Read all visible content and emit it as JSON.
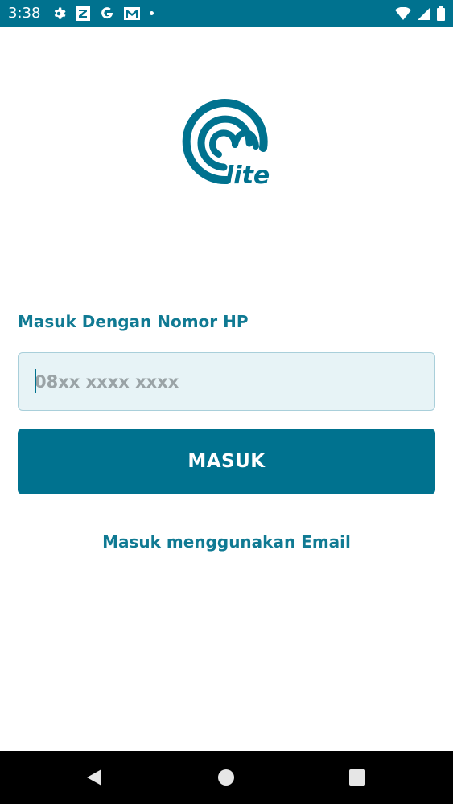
{
  "status_bar": {
    "time": "3:38",
    "left_icons": [
      "gear-icon",
      "z-app-icon",
      "google-g-icon",
      "gmail-icon",
      "notification-dot-icon"
    ],
    "right_icons": [
      "wifi-icon",
      "signal-icon",
      "battery-icon"
    ]
  },
  "logo": {
    "text": "lite",
    "color": "#00728f"
  },
  "login": {
    "label": "Masuk Dengan Nomor HP",
    "phone_placeholder": "08xx xxxx xxxx",
    "phone_value": "",
    "submit_label": "MASUK",
    "email_link": "Masuk menggunakan Email"
  },
  "colors": {
    "primary": "#00728f",
    "input_bg": "#e7f3f6",
    "input_border": "#a9cfda"
  },
  "nav_bar": {
    "buttons": [
      "back-icon",
      "home-icon",
      "recents-icon"
    ]
  }
}
